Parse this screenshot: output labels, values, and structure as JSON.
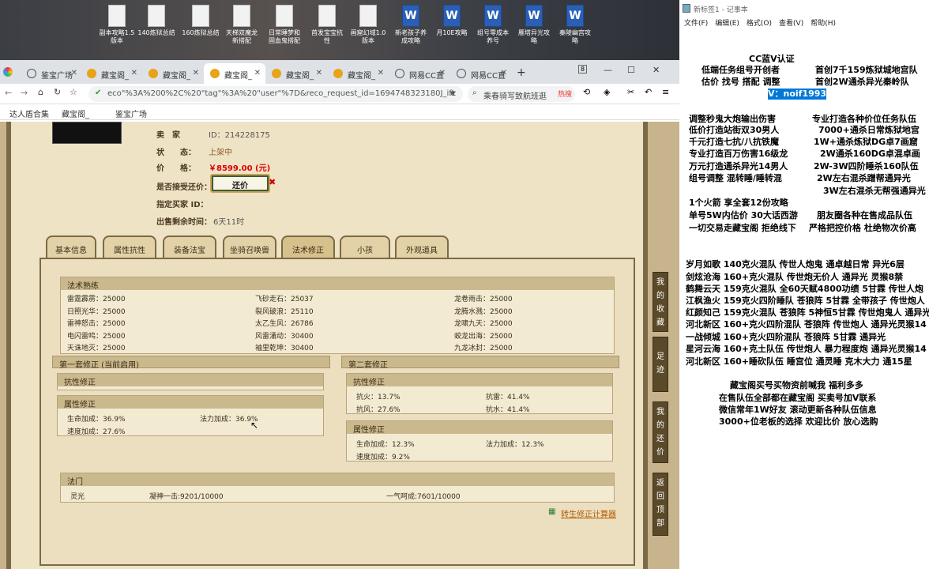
{
  "desktop": {
    "icons": [
      {
        "label1": "副本攻略1.5",
        "label2": "版本",
        "type": "doc"
      },
      {
        "label1": "140炼狱总结",
        "label2": "",
        "type": "doc"
      },
      {
        "label1": "160炼狱总结",
        "label2": "",
        "type": "doc"
      },
      {
        "label1": "天梯双魔龙",
        "label2": "新搭配",
        "type": "doc"
      },
      {
        "label1": "日常睡梦和",
        "label2": "固血鬼搭配",
        "type": "doc"
      },
      {
        "label1": "首发宝宝抗",
        "label2": "性",
        "type": "doc"
      },
      {
        "label1": "画窟幻域1.0",
        "label2": "版本",
        "type": "doc"
      },
      {
        "label1": "新老孩子养",
        "label2": "成攻略",
        "type": "word"
      },
      {
        "label1": "月10E攻略",
        "label2": "",
        "type": "word"
      },
      {
        "label1": "组号零成本",
        "label2": "养号",
        "type": "word"
      },
      {
        "label1": "雁塔异光攻",
        "label2": "略",
        "type": "word"
      },
      {
        "label1": "秦陵幽宫攻",
        "label2": "略",
        "type": "word"
      }
    ]
  },
  "browser": {
    "tabs": [
      {
        "label": "鉴宝广场",
        "fav": "globe"
      },
      {
        "label": "藏宝阁_",
        "fav": "cbg"
      },
      {
        "label": "藏宝阁_",
        "fav": "cbg"
      },
      {
        "label": "藏宝阁_",
        "fav": "cbg"
      },
      {
        "label": "藏宝阁_",
        "fav": "cbg"
      },
      {
        "label": "藏宝阁_",
        "fav": "cbg"
      },
      {
        "label": "网易CC直",
        "fav": "globe"
      },
      {
        "label": "网易CC直",
        "fav": "globe"
      }
    ],
    "tab_count": "8",
    "url": "eco\"%3A%200%2C%20\"tag\"%3A%20\"user\"%7D&reco_request_id=1694748323180J_ifz",
    "search_text": "乘春骑写致航班逛",
    "search_badge": "热搜",
    "bookmarks": [
      "达人盾合集",
      "藏宝阁_",
      "鉴宝广场"
    ]
  },
  "listing": {
    "seller_label": "卖　家",
    "seller_id": "ID：214228175",
    "status_label": "状　　态：",
    "status_value": "上架中",
    "price_label": "价　　格：",
    "price_value": "￥8599.00 (元)",
    "bargain_label": "是否接受还价：",
    "bargain_button": "还价",
    "buyer_label": "指定买家 ID：",
    "time_label": "出售剩余时间：",
    "time_value": "6天11时"
  },
  "game_tabs": [
    "基本信息",
    "属性抗性",
    "装备法宝",
    "坐骑召唤兽",
    "法术修正",
    "小孩",
    "外观道具"
  ],
  "spell_section": {
    "title": "法术熟练",
    "rows": [
      [
        "雷霆霹雳：25000",
        "飞砂走石：25037",
        "龙卷雨击：25000"
      ],
      [
        "日照光华：25000",
        "裂风破浪：25110",
        "龙腾水溅：25000"
      ],
      [
        "雷神怒击：25000",
        "太乙生风：26786",
        "龙啸九天：25000"
      ],
      [
        "电闪雷鸣：25000",
        "风雷涌动：30400",
        "蛟龙出海：25000"
      ],
      [
        "天诛地灭：25000",
        "袖里乾坤：30400",
        "九龙冰封：25000"
      ]
    ]
  },
  "set1": {
    "title": "第一套修正 (当前启用)",
    "resist_title": "抗性修正",
    "attr_title": "属性修正",
    "attr_items": [
      "生命加成：36.9%",
      "法力加成：36.9%",
      "速度加成：27.6%"
    ]
  },
  "set2": {
    "title": "第二套修正",
    "resist_title": "抗性修正",
    "resist_items": [
      "抗火：13.7%",
      "抗雷：41.4%",
      "抗风：27.6%",
      "抗水：41.4%"
    ],
    "attr_title": "属性修正",
    "attr_items": [
      "生命加成：12.3%",
      "法力加成：12.3%",
      "速度加成：9.2%"
    ]
  },
  "fabao": {
    "title": "法门",
    "name": "灵光",
    "item1": "凝神一击:9201/10000",
    "item2": "一气呵成:7601/10000"
  },
  "calc_link": "转生修正计算器",
  "side_buttons": [
    "我的收藏",
    "足迹",
    "我的还价",
    "返回顶部"
  ],
  "notepad": {
    "title": "新标签1 - 记事本",
    "menu": [
      "文件(F)",
      "编辑(E)",
      "格式(O)",
      "查看(V)",
      "帮助(H)"
    ],
    "lines": [
      "CC蓝V认证",
      "低端任务组号开创者",
      "首创7千159炼狱城地宫队",
      "估价 找号 搭配 调整",
      "首创2W通杀异光秦岭队",
      "V：noif1993",
      "调整秒鬼大炮输出伤害",
      "专业打造各种价位任务队伍",
      "低价打造站街双30男人",
      "7000+通杀日常炼狱地宫",
      "千元打造七抗/八抗铁魔",
      "1W+通杀炼狱DG卓7画窟",
      "专业打造百万伤害16级龙",
      "2W通杀160DG卓混卓画",
      "万元打造通杀异光14男人",
      "2W-3W四阶睡杀160队伍",
      "组号调整 混转睡/睡转混",
      "2W左右混杀蹭帮通异光",
      "3W左右混杀无帮强通异光",
      "1个火箭 享全套12份攻略",
      "单号5W内估价 30大话西游",
      "朋友圈各种在售成品队伍",
      "一切交易走藏宝阁 拒绝线下",
      "严格把控价格 杜绝物次价高",
      "岁月如歌 140克火混队 传世人炮鬼 通卓越日常 异光6层",
      "剑炫沧海 160+克火混队 传世炮无价人 通异光 灵猴8禁",
      "鹤舞云天 159克火混队 全60天赋4800功绩 5甘霖 传世人炮",
      "江枫渔火 159克火四阶睡队 苍狼阵 5甘霖 全带孩子 传世炮人",
      "红颜知己 159克火混队 苍狼阵 5神恒5甘霖 传世炮鬼人 通异光",
      "河北新区 160+克火四阶混队 苍狼阵 传世炮人 通异光灵猴14",
      "一战倾城 160+克火四阶混队 苍狼阵 5甘霖 通异光",
      "星河云海 160+克土队伍 传世炮人 暴力程度炮 通异光灵猴14",
      "河北新区 160+睡砍队伍 睡宫位 通灵睡 克木大力 通15星",
      "藏宝阁买号买物资前喊我 福利多多",
      "在售队伍全部都在藏宝阁 买卖号加V联系",
      "微信常年1W好友 滚动更新各种队伍信息",
      "3000+位老板的选择 欢迎比价 放心选购"
    ]
  }
}
